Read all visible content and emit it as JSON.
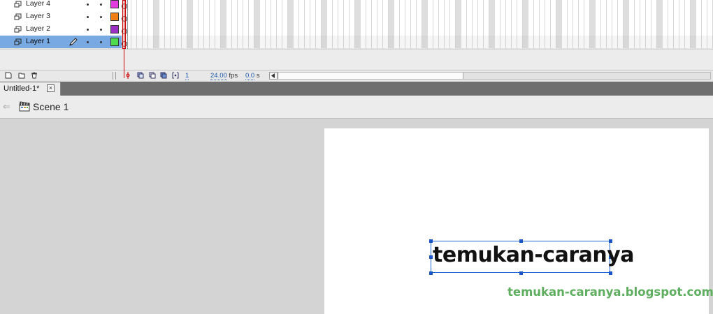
{
  "timeline": {
    "layers": [
      {
        "name": "Layer 4",
        "color": "#e23be0",
        "selected": false
      },
      {
        "name": "Layer 3",
        "color": "#f07f16",
        "selected": false
      },
      {
        "name": "Layer 2",
        "color": "#9b2fc4",
        "selected": false
      },
      {
        "name": "Layer 1",
        "color": "#4cdc4c",
        "selected": true
      }
    ],
    "toolbar": {
      "current_frame": "1",
      "frame_rate": "24.00",
      "frame_rate_unit": "fps",
      "elapsed_time": "0.0",
      "elapsed_unit": "s"
    }
  },
  "document": {
    "tab_title": "Untitled-1*",
    "close_glyph": "×"
  },
  "scene": {
    "label": "Scene 1"
  },
  "stage": {
    "text": "temukan-caranya",
    "watermark": "temukan-caranya.blogspot.com"
  },
  "colors": {
    "selection": "#78a9e3",
    "text_box_border": "#1a66d6",
    "watermark": "#5fae60",
    "playhead": "#d00000"
  },
  "icons": {
    "layer": "layer-page-icon",
    "pencil": "pencil-icon",
    "new_layer": "new-layer-icon",
    "new_folder": "new-folder-icon",
    "delete": "trash-icon",
    "center_frame": "center-frame-icon",
    "onion_skin": "onion-skin-icon",
    "onion_outlines": "onion-skin-outlines-icon",
    "edit_multiple": "edit-multiple-frames-icon",
    "modify_markers": "modify-onion-markers-icon",
    "scene": "clapperboard-icon",
    "back": "back-arrow-icon"
  }
}
